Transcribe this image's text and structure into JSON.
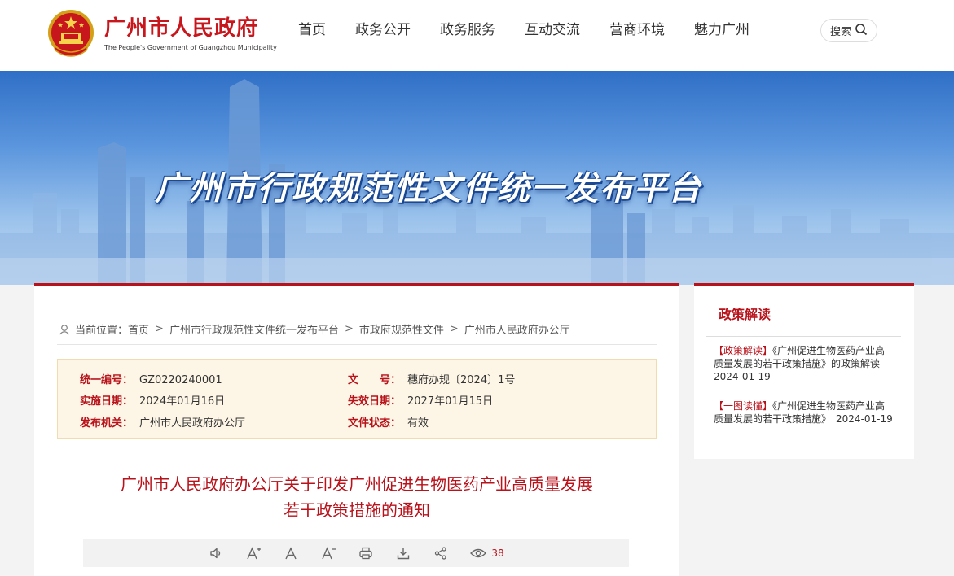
{
  "header": {
    "site_name_cn": "广州市人民政府",
    "site_name_en": "The People's Government of Guangzhou Municipality",
    "nav": [
      "首页",
      "政务公开",
      "政务服务",
      "互动交流",
      "营商环境",
      "魅力广州"
    ],
    "search_label": "搜索"
  },
  "banner": {
    "title": "广州市行政规范性文件统一发布平台"
  },
  "breadcrumb": {
    "prefix": "当前位置：",
    "items": [
      "首页",
      "广州市行政规范性文件统一发布平台",
      "市政府规范性文件",
      "广州市人民政府办公厅"
    ],
    "separator": ">"
  },
  "meta": {
    "code_label": "统一编号：",
    "code": "GZ0220240001",
    "docno_label": "文　　号：",
    "docno": "穗府办规〔2024〕1号",
    "start_label": "实施日期：",
    "start": "2024年01月16日",
    "end_label": "失效日期：",
    "end": "2027年01月15日",
    "issuer_label": "发布机关：",
    "issuer": "广州市人民政府办公厅",
    "status_label": "文件状态：",
    "status": "有效"
  },
  "document": {
    "title_line1": "广州市人民政府办公厅关于印发广州促进生物医药产业高质量发展",
    "title_line2": "若干政策措施的通知"
  },
  "toolbar": {
    "icons": [
      "speaker-icon",
      "font-increase-icon",
      "font-default-icon",
      "font-decrease-icon",
      "print-icon",
      "download-icon",
      "share-icon",
      "eye-icon"
    ],
    "view_count": "38"
  },
  "sidebar": {
    "title": "政策解读",
    "items": [
      {
        "tag": "【政策解读】",
        "text": "《广州促进生物医药产业高质量发展的若干政策措施》的政策解读",
        "date": "2024-01-19"
      },
      {
        "tag": "【一图读懂】",
        "text": "《广州促进生物医药产业高质量发展的若干政策措施》",
        "date": "2024-01-19"
      }
    ]
  },
  "colors": {
    "accent": "#b8121b",
    "meta_bg": "#fdf6e6"
  }
}
